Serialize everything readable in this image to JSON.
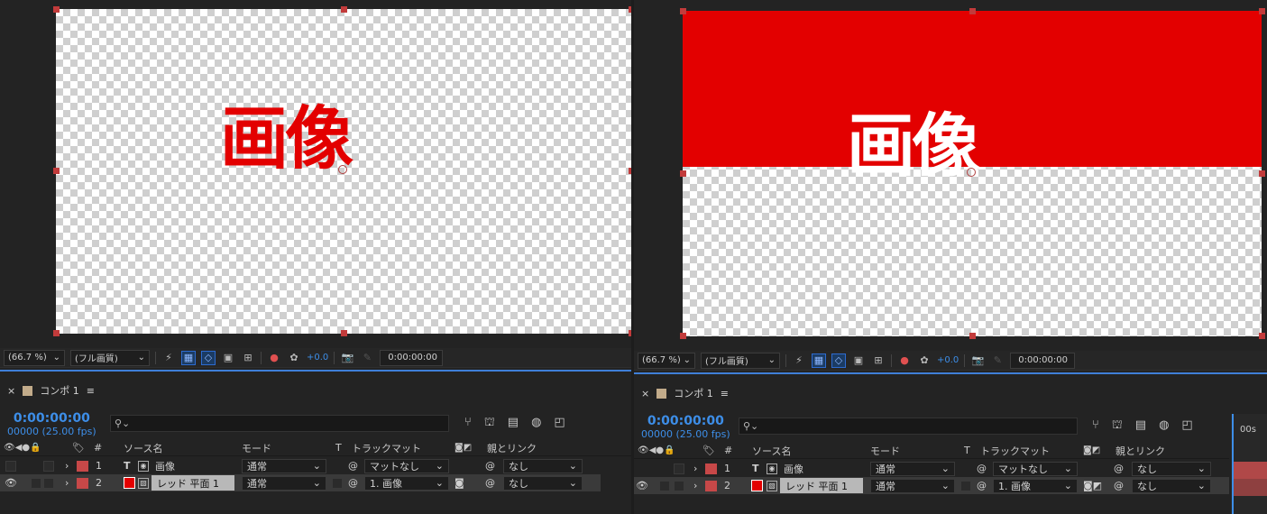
{
  "left": {
    "viewer": {
      "zoom": "(66.7 %)",
      "quality": "(フル画質)",
      "exposure": "+0.0",
      "timecode": "0:00:00:00",
      "kanji": "画像"
    },
    "comp": {
      "tab_label": "コンポ 1",
      "menu_icon": "≡",
      "close_icon": "×",
      "timecode": "0:00:00:00",
      "fps": "00000 (25.00 fps)",
      "search_placeholder": ""
    },
    "columns": {
      "hash": "#",
      "source": "ソース名",
      "mode": "モード",
      "t": "T",
      "trackmatte": "トラックマット",
      "parent": "親とリンク"
    },
    "layers": [
      {
        "num": "1",
        "type": "T",
        "name": "画像",
        "mode": "通常",
        "matte": "マットなし",
        "parent": "なし"
      },
      {
        "num": "2",
        "type": "solid",
        "name": "レッド 平面 1",
        "mode": "通常",
        "matte": "1. 画像",
        "parent": "なし"
      }
    ]
  },
  "right": {
    "viewer": {
      "zoom": "(66.7 %)",
      "quality": "(フル画質)",
      "exposure": "+0.0",
      "timecode": "0:00:00:00",
      "kanji": "画像"
    },
    "comp": {
      "tab_label": "コンポ 1",
      "menu_icon": "≡",
      "close_icon": "×",
      "timecode": "0:00:00:00",
      "fps": "00000 (25.00 fps)",
      "search_placeholder": "",
      "ruler": "00s"
    },
    "columns": {
      "hash": "#",
      "source": "ソース名",
      "mode": "モード",
      "t": "T",
      "trackmatte": "トラックマット",
      "parent": "親とリンク"
    },
    "layers": [
      {
        "num": "1",
        "type": "T",
        "name": "画像",
        "mode": "通常",
        "matte": "マットなし",
        "parent": "なし"
      },
      {
        "num": "2",
        "type": "solid",
        "name": "レッド 平面 1",
        "mode": "通常",
        "matte": "1. 画像",
        "parent": "なし"
      }
    ]
  },
  "colors": {
    "red": "#e30000",
    "accent": "#3d8ee8",
    "label": "#c74848"
  }
}
